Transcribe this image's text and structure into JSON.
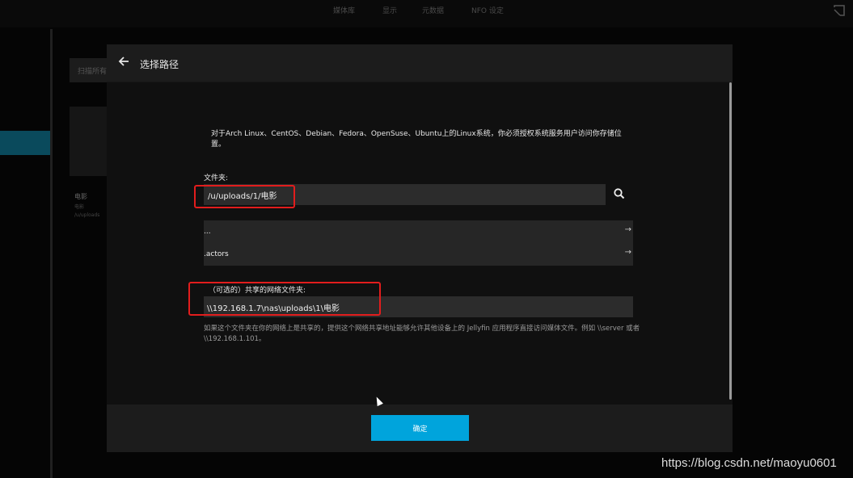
{
  "topnav": {
    "tabs": [
      "媒体库",
      "显示",
      "元数据",
      "NFO 设定"
    ]
  },
  "background": {
    "scan_button_label": "扫描所有媒体库",
    "card_title": "电影",
    "card_subtitle_1": "电影",
    "card_subtitle_2": "/u/uploads"
  },
  "modal": {
    "title": "选择路径",
    "info_text": "对于Arch Linux、CentOS、Debian、Fedora、OpenSuse、Ubuntu上的Linux系统，你必须授权系统服务用户访问你存储位置。",
    "folder_label": "文件夹:",
    "folder_value": "/u/uploads/1/电影",
    "directory_items": [
      {
        "label": "..."
      },
      {
        "label": ".actors"
      }
    ],
    "share_label": "（可选的）共享的网络文件夹:",
    "share_value": "\\\\192.168.1.7\\nas\\uploads\\1\\电影",
    "share_help": "如果这个文件夹在你的网络上是共享的，提供这个网络共享地址能够允许其他设备上的 Jellyfin 应用程序直接访问媒体文件。例如 \\\\server 或者 \\\\192.168.1.101。",
    "ok_label": "确定"
  },
  "icons": {
    "back": "arrow-left-icon",
    "search": "search-icon",
    "item_arrow": "arrow-right-icon"
  },
  "colors": {
    "accent": "#00a4dc",
    "highlight_box": "#e21d1d"
  },
  "watermark": "https://blog.csdn.net/maoyu0601"
}
